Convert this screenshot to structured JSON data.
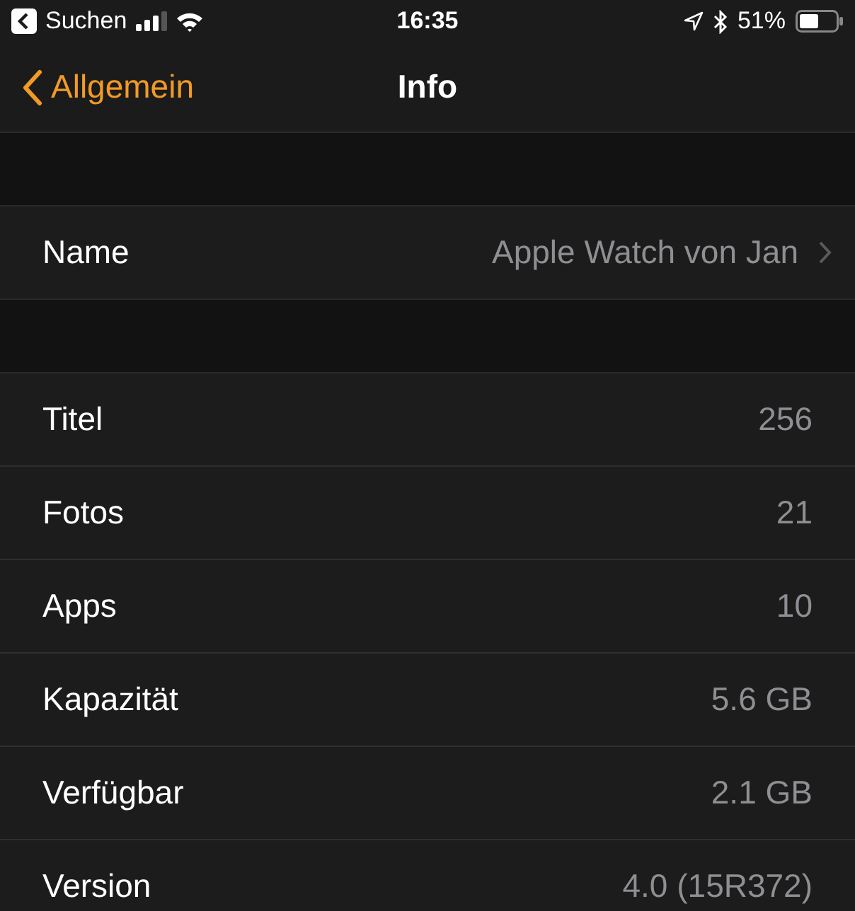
{
  "status_bar": {
    "back_app": "Suchen",
    "time": "16:35",
    "battery": "51%"
  },
  "nav": {
    "back": "Allgemein",
    "title": "Info"
  },
  "name_row": {
    "label": "Name",
    "value": "Apple Watch von Jan"
  },
  "info_rows": [
    {
      "label": "Titel",
      "value": "256"
    },
    {
      "label": "Fotos",
      "value": "21"
    },
    {
      "label": "Apps",
      "value": "10"
    },
    {
      "label": "Kapazität",
      "value": "5.6 GB"
    },
    {
      "label": "Verfügbar",
      "value": "2.1 GB"
    },
    {
      "label": "Version",
      "value": "4.0 (15R372)"
    }
  ]
}
